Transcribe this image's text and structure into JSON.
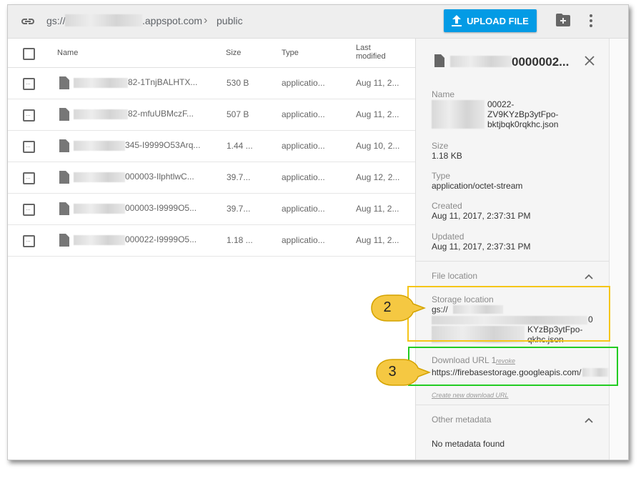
{
  "topbar": {
    "path_prefix": "gs://",
    "path_domain": ".appspot.com",
    "path_folder": "public",
    "upload_label": "UPLOAD FILE"
  },
  "list": {
    "headers": {
      "name": "Name",
      "size": "Size",
      "type": "Type",
      "modified_line1": "Last",
      "modified_line2": "modified"
    },
    "rows": [
      {
        "name_suffix": "82-1TnjBALHTX...",
        "size": "530 B",
        "type": "applicatio...",
        "modified": "Aug 11, 2..."
      },
      {
        "name_suffix": "82-mfuUBMczF...",
        "size": "507 B",
        "type": "applicatio...",
        "modified": "Aug 11, 2..."
      },
      {
        "name_suffix": "345-I9999O53Arq...",
        "size": "1.44 ...",
        "type": "applicatio...",
        "modified": "Aug 10, 2..."
      },
      {
        "name_suffix": "000003-IlphtlwC...",
        "size": "39.7...",
        "type": "applicatio...",
        "modified": "Aug 12, 2..."
      },
      {
        "name_suffix": "000003-I9999O5...",
        "size": "39.7...",
        "type": "applicatio...",
        "modified": "Aug 11, 2..."
      },
      {
        "name_suffix": "000022-I9999O5...",
        "size": "1.18 ...",
        "type": "applicatio...",
        "modified": "Aug 11, 2..."
      }
    ]
  },
  "details": {
    "title": "0000002...",
    "name_label": "Name",
    "name_line1": "00022-",
    "name_line2": "ZV9KYzBp3ytFpo-",
    "name_line3": "bktjbqk0rqkhc.json",
    "size_label": "Size",
    "size_value": "1.18 KB",
    "type_label": "Type",
    "type_value": "application/octet-stream",
    "created_label": "Created",
    "created_value": "Aug 11, 2017, 2:37:31 PM",
    "updated_label": "Updated",
    "updated_value": "Aug 11, 2017, 2:37:31 PM",
    "file_location_title": "File location",
    "storage_label": "Storage location",
    "storage_line1": "gs://",
    "storage_line2": "0",
    "storage_line3": "KYzBp3ytFpo-",
    "storage_line4": "qkhc.json",
    "download_label": "Download URL 1",
    "revoke_label": "revoke",
    "download_url": "https://firebasestorage.googleapis.com/",
    "create_link": "Create new download URL",
    "other_metadata_title": "Other metadata",
    "no_metadata": "No metadata found"
  },
  "annotations": {
    "callout_2": "2",
    "callout_3": "3"
  },
  "colors": {
    "accent": "#039be5",
    "highlight_yellow": "#f5c518",
    "highlight_green": "#22cc22"
  }
}
